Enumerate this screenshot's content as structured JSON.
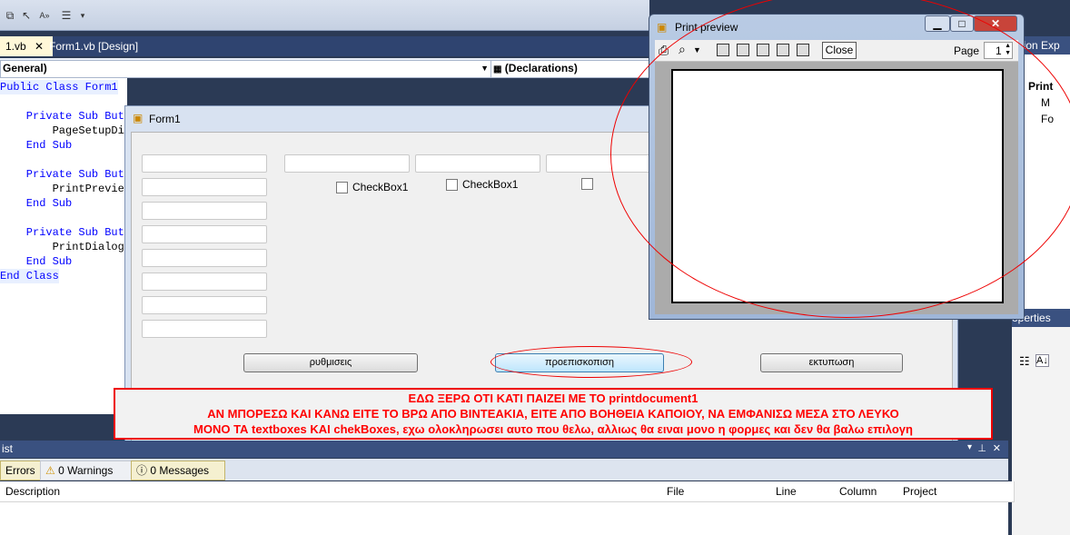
{
  "tabs": {
    "tab1": "1.vb",
    "tab2": "Form1.vb [Design]"
  },
  "decl_bar": {
    "left_combo": "General)",
    "right_combo": "(Declarations)"
  },
  "code": {
    "line1": "Public Class Form1",
    "line2": "    Private Sub But",
    "line3": "        PageSetupDi",
    "line4": "    End Sub",
    "line5": "    Private Sub But",
    "line6": "        PrintPrevie",
    "line7": "    End Sub",
    "line8": "    Private Sub But",
    "line9": "        PrintDialog",
    "line10": "    End Sub",
    "line11": "End Class"
  },
  "form1": {
    "title": "Form1",
    "checkbox1": "CheckBox1",
    "checkbox2": "CheckBox1",
    "button_settings": "ρυθμισεις",
    "button_preview": "προεπισκοπιση",
    "button_print": "εκτυπωση"
  },
  "annotation": {
    "line1": "ΕΔΩ ΞΕΡΩ ΟΤΙ ΚΑΤΙ ΠΑΙΖΕΙ ΜΕ ΤΟ printdocument1",
    "line2": "ΑΝ ΜΠΟΡΕΣΩ ΚΑΙ ΚΑΝΩ ΕΙΤΕ ΤΟ ΒΡΩ ΑΠΟ ΒΙΝΤΕΑΚΙΑ, ΕΙΤΕ ΑΠΟ ΒΟΗΘΕΙΑ ΚΑΠΟΙΟΥ, ΝΑ ΕΜΦΑΝΙΣΩ ΜΕΣΑ ΣΤΟ ΛΕΥΚΟ",
    "line3": "ΜΟΝΟ ΤΑ textboxes ΚΑΙ chekBoxes, εχω ολοκληρωσει αυτο που θελω, αλλιως θα ειναι μονο η φορμες και δεν θα βαλω επιλογη"
  },
  "error_list": {
    "title": "ist",
    "tab_errors": "Errors",
    "tab_warnings": "0 Warnings",
    "tab_messages": "0 Messages",
    "columns": [
      "Description",
      "File",
      "Line",
      "Column",
      "Project"
    ]
  },
  "solution_explorer": {
    "title": "lution Exp",
    "item1": "Print",
    "item2": "M",
    "item3": "Fo"
  },
  "properties": {
    "title": "operties"
  },
  "print_preview": {
    "title": "Print preview",
    "close_label": "Close",
    "page_label": "Page",
    "page_value": "1"
  }
}
